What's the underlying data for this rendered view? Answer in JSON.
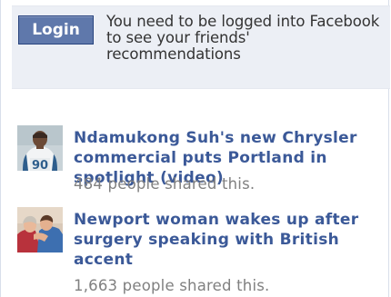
{
  "login": {
    "button_label": "Login",
    "message": "You need to be logged into Facebook to see your friends' recommendations"
  },
  "stories": [
    {
      "title": "Ndamukong Suh's new Chrysler commercial puts Portland in spotlight (video)",
      "shares": "484 people shared this.",
      "thumb_icon": "football-player-thumbnail"
    },
    {
      "title": "Newport woman wakes up after surgery speaking with British accent",
      "shares": "1,663 people shared this.",
      "thumb_icon": "hug-photo-thumbnail"
    }
  ],
  "colors": {
    "link": "#3b5998",
    "login_bg": "#eceff5",
    "button_bg": "#5f78ab",
    "muted": "#808080"
  }
}
